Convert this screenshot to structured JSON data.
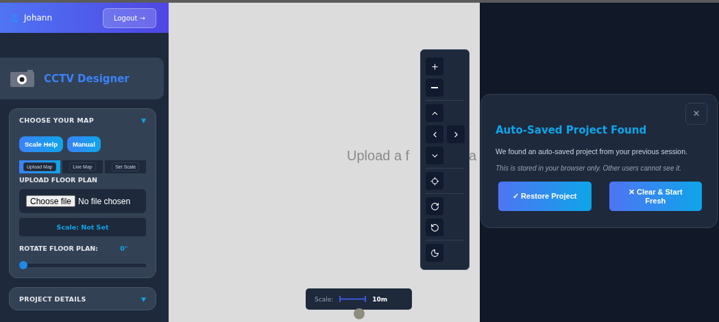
{
  "user": {
    "name": "Johann",
    "logout": "Logout →"
  },
  "app": {
    "title": "CCTV Designer"
  },
  "sections": [
    {
      "title": "CHOOSE YOUR MAP",
      "expanded": true,
      "arrow": "▼",
      "buttons": [
        "Scale Help",
        "Manual"
      ],
      "tabs": [
        {
          "label": "Upload Map",
          "selected": true
        },
        {
          "label": "Live Map",
          "selected": false
        },
        {
          "label": "Set Scale",
          "selected": false
        }
      ],
      "upload_label": "UPLOAD FLOOR PLAN",
      "file_button": "Choose file",
      "file_status": "No file chosen",
      "scale_status": "Scale: Not Set",
      "rotate_label": "ROTATE FLOOR PLAN:",
      "rotate_value": "0°",
      "rotate": {
        "level": 0
      }
    },
    {
      "title": "PROJECT DETAILS",
      "expanded": false,
      "arrow": "▼"
    }
  ],
  "canvas": {
    "placeholder_parts": [
      "Upload a f",
      "a"
    ],
    "tools": [
      {
        "kind": "zoom-in"
      },
      {
        "kind": "zoom-out"
      },
      {
        "kind": "up"
      },
      {
        "kind": "left"
      },
      {
        "kind": "right"
      },
      {
        "kind": "down"
      },
      {
        "kind": "recenter"
      },
      {
        "kind": "rotate-cw"
      },
      {
        "kind": "rotate-ccw"
      },
      {
        "kind": "theme"
      }
    ],
    "scale": {
      "label": "Scale:",
      "value": "10m"
    }
  },
  "dialog": {
    "title": "Auto-Saved Project Found",
    "close": "×",
    "message": "We found an auto-saved project from your previous session.",
    "note": "This is stored in your browser only. Other users cannot see it.",
    "buttons": [
      "✓ Restore Project",
      "✕ Clear & Start Fresh"
    ]
  }
}
